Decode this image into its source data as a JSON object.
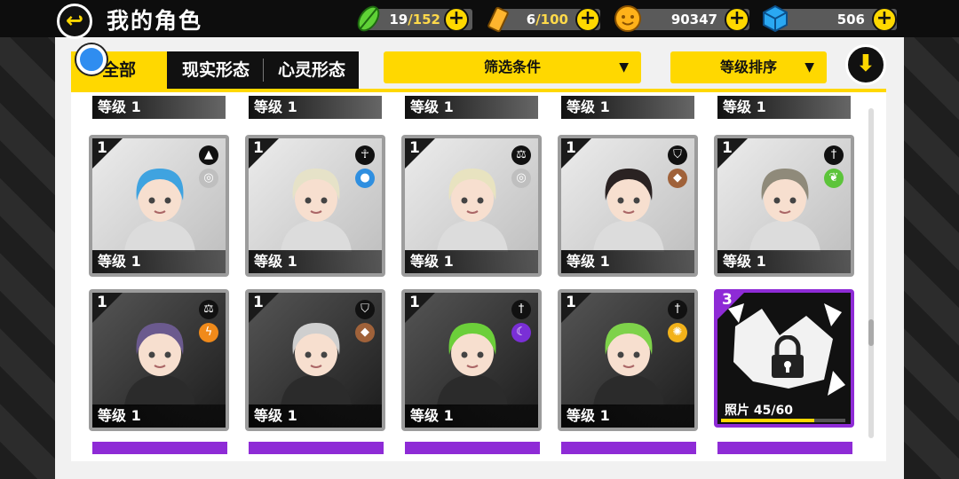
{
  "header": {
    "title": "我的角色",
    "stamina": {
      "current": "19",
      "max": "/152"
    },
    "battery": {
      "current": "6",
      "max": "/100"
    },
    "coins": "90347",
    "gems": "506"
  },
  "tabs": [
    {
      "label": "全部",
      "active": true
    },
    {
      "label": "现实形态",
      "active": false
    },
    {
      "label": "心灵形态",
      "active": false
    }
  ],
  "filter": {
    "label": "筛选条件",
    "arrow": "▼"
  },
  "sort": {
    "label": "等级排序",
    "arrow": "▼"
  },
  "top_partial_row": [
    "等级 1",
    "等级 1",
    "等级 1",
    "等级 1",
    "等级 1"
  ],
  "cards": [
    {
      "rank": "1",
      "level": "等级 1",
      "class_icon": "triforce-icon",
      "element_icon": "wind-icon",
      "element_color": "#bfbfbf",
      "hair": "#3fa3e0"
    },
    {
      "rank": "1",
      "level": "等级 1",
      "class_icon": "ankh-icon",
      "element_icon": "water-icon",
      "element_color": "#2f8fe0",
      "hair": "#e6e2c8"
    },
    {
      "rank": "1",
      "level": "等级 1",
      "class_icon": "scales-icon",
      "element_icon": "wind-icon",
      "element_color": "#bfbfbf",
      "hair": "#e8e3c0"
    },
    {
      "rank": "1",
      "level": "等级 1",
      "class_icon": "shield-icon",
      "element_icon": "earth-icon",
      "element_color": "#a0623a",
      "hair": "#2a2222"
    },
    {
      "rank": "1",
      "level": "等级 1",
      "class_icon": "sword-icon",
      "element_icon": "leaf-icon",
      "element_color": "#5cc43a",
      "hair": "#8f8a7a"
    },
    {
      "rank": "1",
      "level": "等级 1",
      "class_icon": "scales-icon",
      "element_icon": "lightning-icon",
      "element_color": "#f08a1a",
      "hair": "#6b5a8e"
    },
    {
      "rank": "1",
      "level": "等级 1",
      "class_icon": "shield-icon",
      "element_icon": "earth-icon",
      "element_color": "#a0623a",
      "hair": "#cfcfcf"
    },
    {
      "rank": "1",
      "level": "等级 1",
      "class_icon": "sword-icon",
      "element_icon": "moon-icon",
      "element_color": "#7a2fd6",
      "hair": "#6ccf3a"
    },
    {
      "rank": "1",
      "level": "等级 1",
      "class_icon": "sword-icon",
      "element_icon": "sun-icon",
      "element_color": "#f2b21a",
      "hair": "#7ed24a"
    }
  ],
  "locked_card": {
    "rank": "3",
    "photo_label": "照片",
    "photo_count": "45",
    "photo_max": "/60",
    "progress": 0.75
  }
}
